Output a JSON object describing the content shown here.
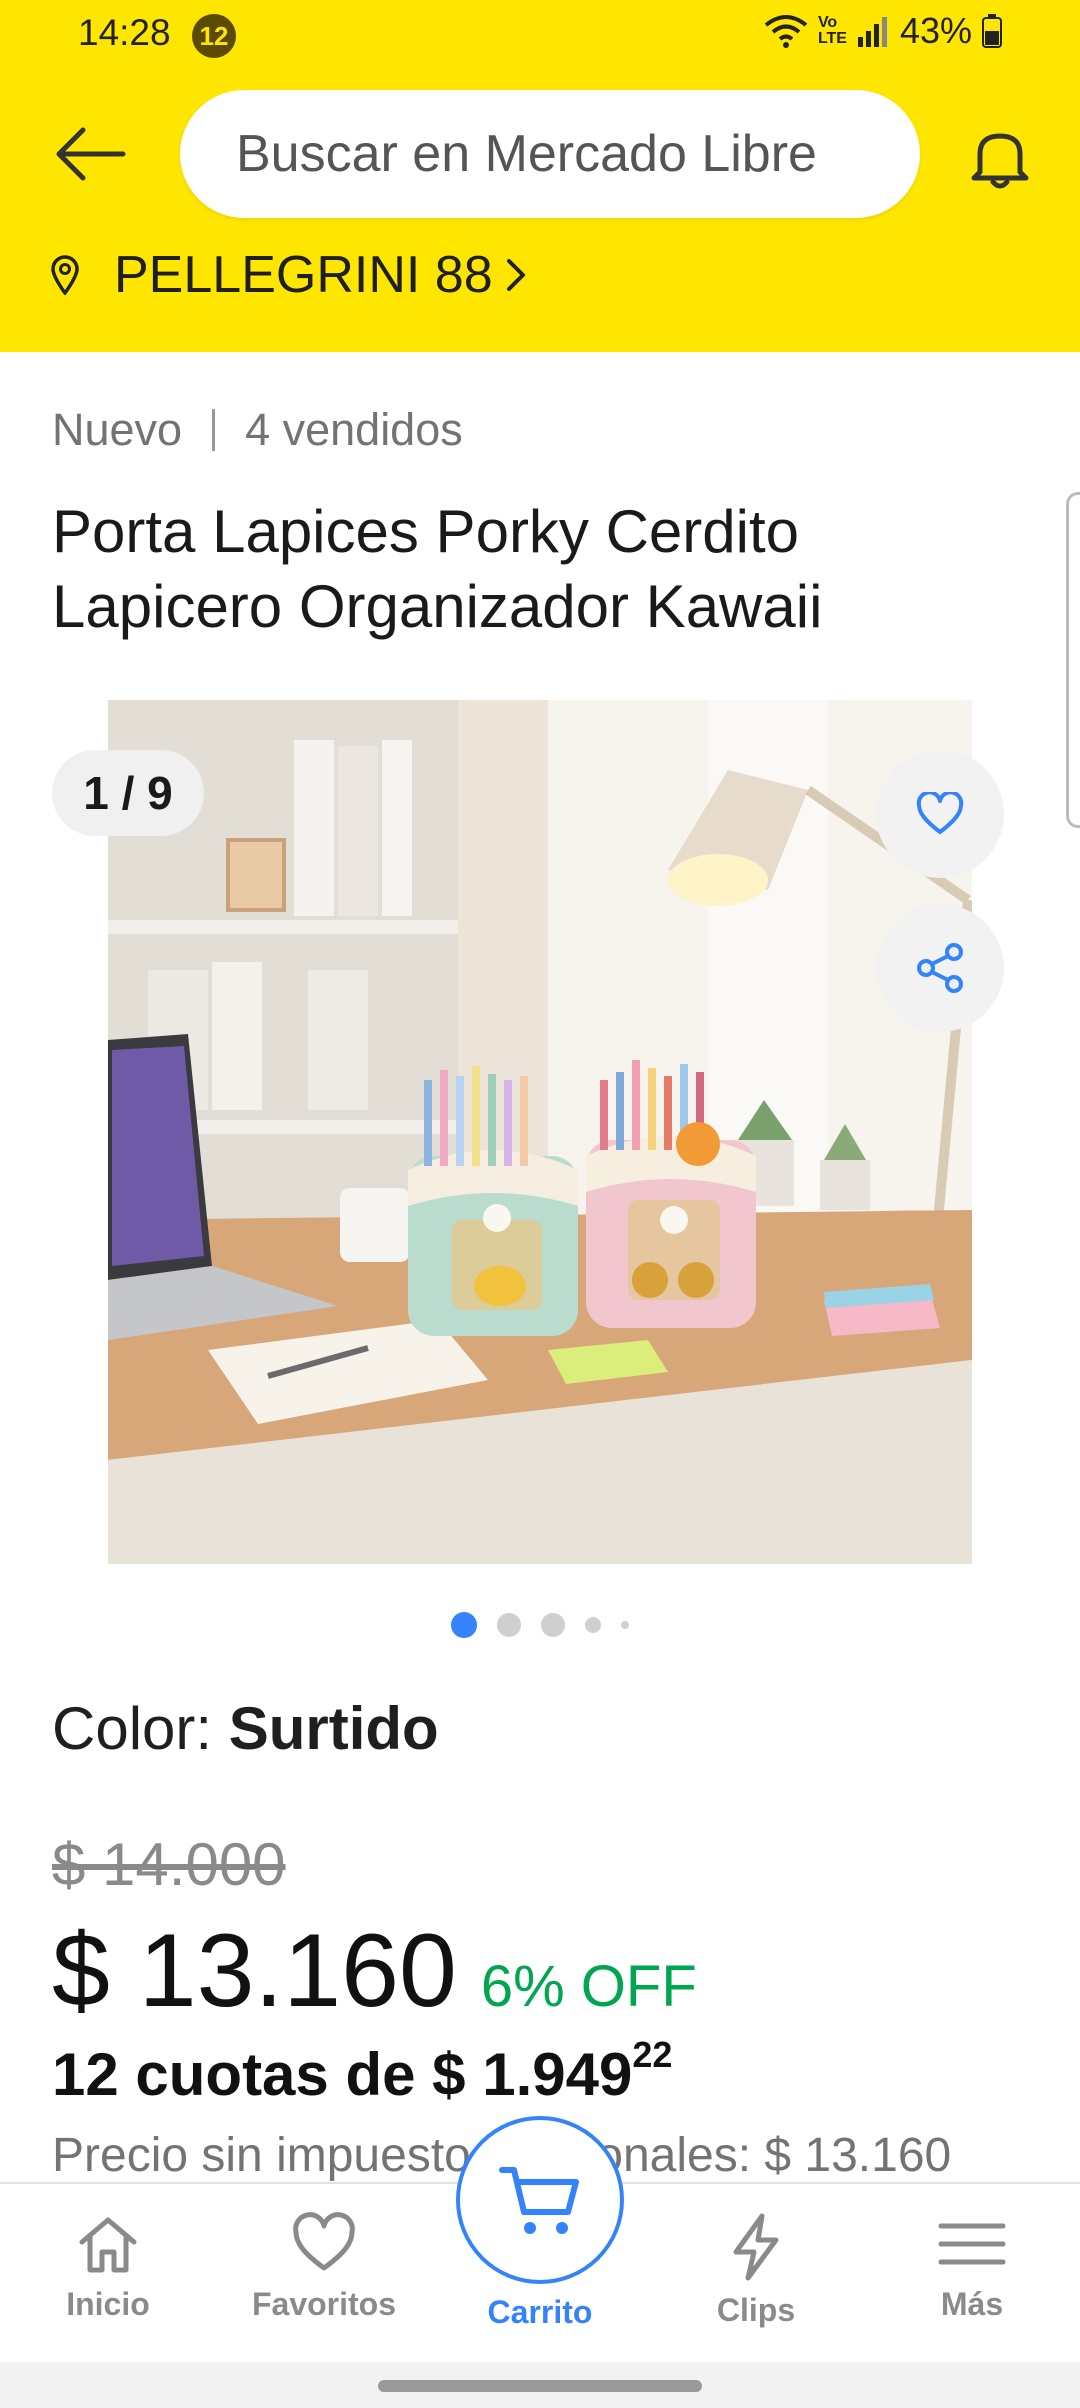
{
  "status_bar": {
    "time": "14:28",
    "notification_count": "12",
    "network": "Vo LTE",
    "battery": "43%"
  },
  "header": {
    "search_placeholder": "Buscar en Mercado Libre",
    "address": "PELLEGRINI 88"
  },
  "product": {
    "condition": "Nuevo",
    "sold": "4 vendidos",
    "title": "Porta Lapices Porky Cerdito Lapicero Organizador Kawaii",
    "gallery_counter": "1 / 9",
    "color_label": "Color: ",
    "color_value": "Surtido",
    "old_price": "$ 14.000",
    "price": "$ 13.160",
    "discount": "6% OFF",
    "installments_main": "12 cuotas de $ 1.949",
    "installments_cents": "22",
    "tax_note": "Precio sin impuestos nacionales: $ 13.160"
  },
  "bottom_nav": {
    "items": [
      {
        "label": "Inicio",
        "icon": "home-icon"
      },
      {
        "label": "Favoritos",
        "icon": "heart-icon"
      },
      {
        "label": "Carrito",
        "icon": "cart-icon"
      },
      {
        "label": "Clips",
        "icon": "lightning-icon"
      },
      {
        "label": "Más",
        "icon": "menu-icon"
      }
    ]
  },
  "colors": {
    "brand_yellow": "#ffe600",
    "accent_blue": "#3483fa",
    "discount_green": "#00a650"
  }
}
